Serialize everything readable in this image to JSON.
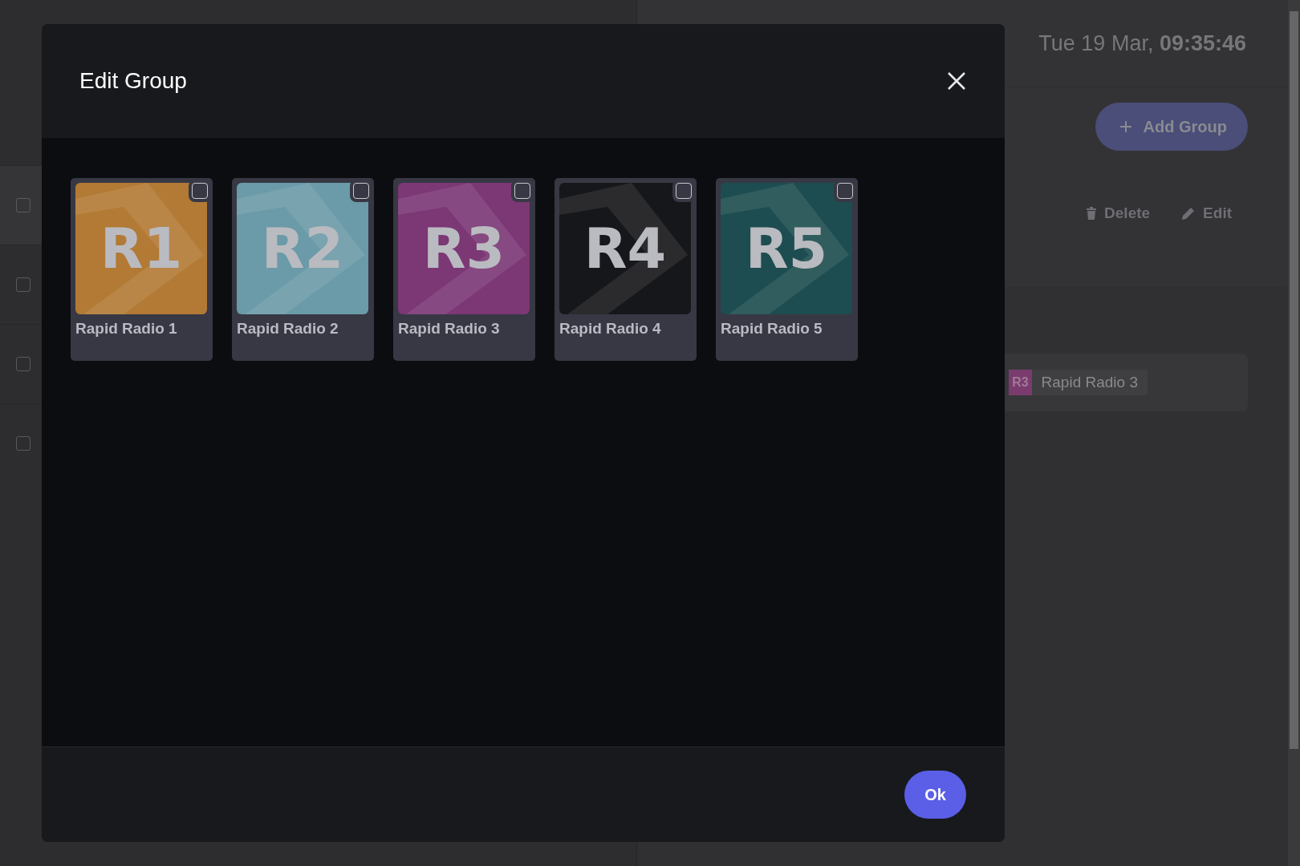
{
  "background": {
    "date": "Tue 19 Mar,",
    "time": "09:35:46",
    "add_button": "Add Group",
    "actions": [
      "Delete",
      "Edit"
    ],
    "rows": [
      {
        "checked": false
      },
      {
        "checked": false
      },
      {
        "checked": false
      },
      {
        "checked": false
      }
    ],
    "chip": {
      "badge": "R3",
      "label": "Rapid Radio 3",
      "color": "#7a3c6e"
    }
  },
  "dialog": {
    "title": "Edit Group",
    "stations": [
      {
        "badge": "R1",
        "name": "Rapid Radio 1",
        "color": "#b27a35",
        "checked": false
      },
      {
        "badge": "R2",
        "name": "Rapid Radio 2",
        "color": "#6b9aa8",
        "checked": false
      },
      {
        "badge": "R3",
        "name": "Rapid Radio 3",
        "color": "#7c3775",
        "checked": false
      },
      {
        "badge": "R4",
        "name": "Rapid Radio 4",
        "color": "#16171a",
        "checked": false
      },
      {
        "badge": "R5",
        "name": "Rapid Radio 5",
        "color": "#1d4d50",
        "checked": false
      }
    ],
    "ok_button": "Ok"
  }
}
